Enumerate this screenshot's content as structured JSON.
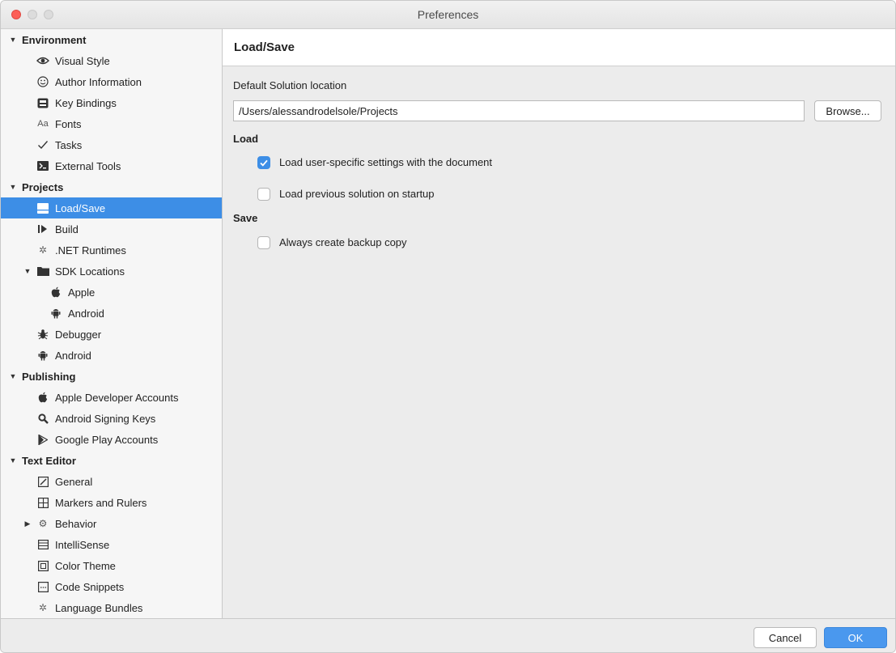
{
  "window": {
    "title": "Preferences"
  },
  "sidebar": {
    "items": [
      {
        "label": "Environment",
        "icon": "triangle-down"
      },
      {
        "label": "Visual Style",
        "icon": "eye-icon"
      },
      {
        "label": "Author Information",
        "icon": "smiley-icon"
      },
      {
        "label": "Key Bindings",
        "icon": "keyboard-icon"
      },
      {
        "label": "Fonts",
        "icon": "aa-icon",
        "glyph": "Aa"
      },
      {
        "label": "Tasks",
        "icon": "checkmark-icon"
      },
      {
        "label": "External Tools",
        "icon": "terminal-icon"
      },
      {
        "label": "Projects",
        "icon": "triangle-down"
      },
      {
        "label": "Load/Save",
        "icon": "disk-icon"
      },
      {
        "label": "Build",
        "icon": "build-icon"
      },
      {
        "label": ".NET Runtimes",
        "icon": "gear-icon"
      },
      {
        "label": "SDK Locations",
        "icon": "folder-icon"
      },
      {
        "label": "Apple",
        "icon": "apple-icon"
      },
      {
        "label": "Android",
        "icon": "android-icon"
      },
      {
        "label": "Debugger",
        "icon": "bug-icon"
      },
      {
        "label": "Android",
        "icon": "android-icon"
      },
      {
        "label": "Publishing",
        "icon": "triangle-down"
      },
      {
        "label": "Apple Developer Accounts",
        "icon": "apple-icon"
      },
      {
        "label": "Android Signing Keys",
        "icon": "magnifier-key-icon"
      },
      {
        "label": "Google Play Accounts",
        "icon": "play-icon"
      },
      {
        "label": "Text Editor",
        "icon": "triangle-down"
      },
      {
        "label": "General",
        "icon": "edit-icon"
      },
      {
        "label": "Markers and Rulers",
        "icon": "ruler-grid-icon"
      },
      {
        "label": "Behavior",
        "icon": "behavior-icon"
      },
      {
        "label": "IntelliSense",
        "icon": "list-icon"
      },
      {
        "label": "Color Theme",
        "icon": "color-theme-icon"
      },
      {
        "label": "Code Snippets",
        "icon": "snippet-icon"
      },
      {
        "label": "Language Bundles",
        "icon": "gear-icon"
      }
    ],
    "selected": "Load/Save",
    "selected_color": "#3d8ee6"
  },
  "content": {
    "title": "Load/Save",
    "default_location_label": "Default Solution location",
    "default_location_value": "/Users/alessandrodelsole/Projects",
    "browse_label": "Browse...",
    "load_heading": "Load",
    "load_user_settings": {
      "label": "Load user-specific settings with the document",
      "checked": true
    },
    "load_previous_solution": {
      "label": "Load previous solution on startup",
      "checked": false
    },
    "save_heading": "Save",
    "always_backup": {
      "label": "Always create backup copy",
      "checked": false
    }
  },
  "footer": {
    "cancel_label": "Cancel",
    "ok_label": "OK",
    "ok_color": "#4a98ee"
  }
}
